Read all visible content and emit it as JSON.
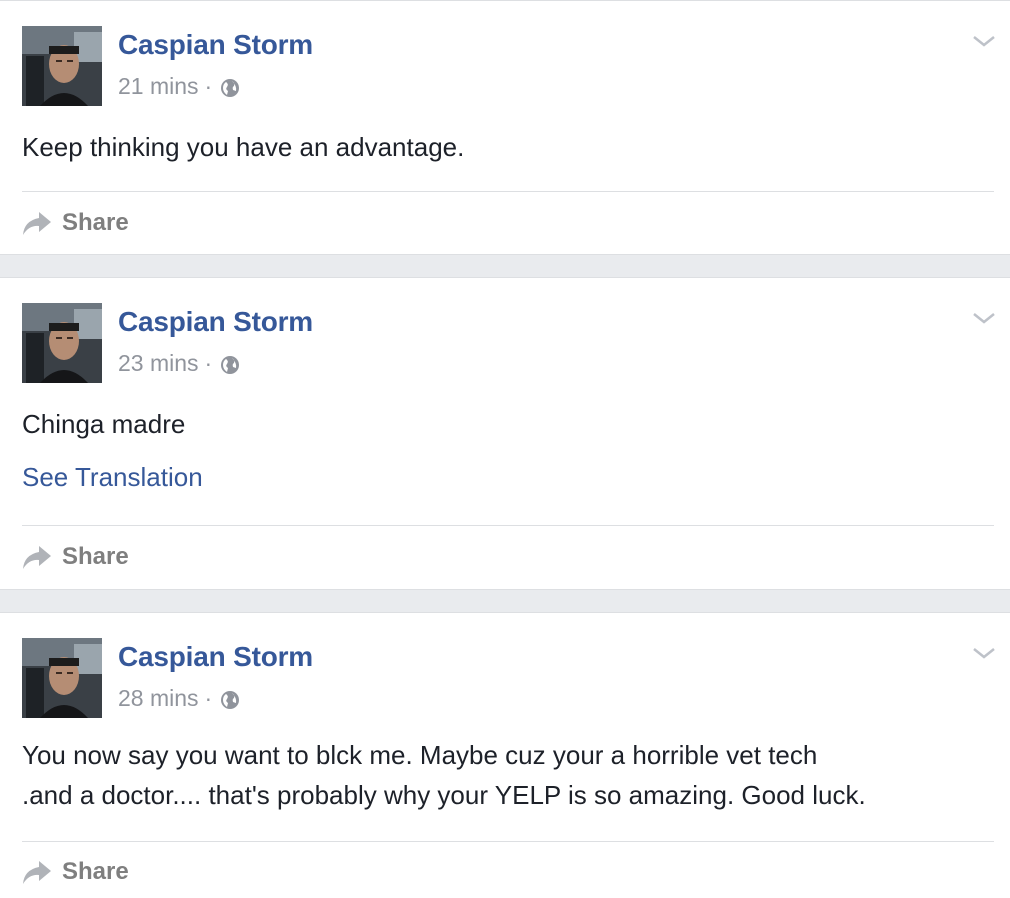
{
  "colors": {
    "author_link": "#365899",
    "meta_text": "#90949c",
    "body_text": "#1d2129",
    "share_text": "#7f7f7f",
    "feed_background": "#e9ebee"
  },
  "posts": [
    {
      "author": "Caspian Storm",
      "time": "21 mins",
      "separator": "·",
      "audience_icon": "globe-icon",
      "text": "Keep thinking you have an advantage.",
      "share_label": "Share"
    },
    {
      "author": "Caspian Storm",
      "time": "23 mins",
      "separator": "·",
      "audience_icon": "globe-icon",
      "text": "Chinga madre",
      "see_translation": "See Translation",
      "share_label": "Share"
    },
    {
      "author": "Caspian Storm",
      "time": "28 mins",
      "separator": "·",
      "audience_icon": "globe-icon",
      "text_lines": [
        "You now say you want to blck me. Maybe cuz your a horrible vet tech",
        ".and a doctor.... that's probably why your YELP is so amazing. Good luck."
      ],
      "share_label": "Share"
    }
  ]
}
